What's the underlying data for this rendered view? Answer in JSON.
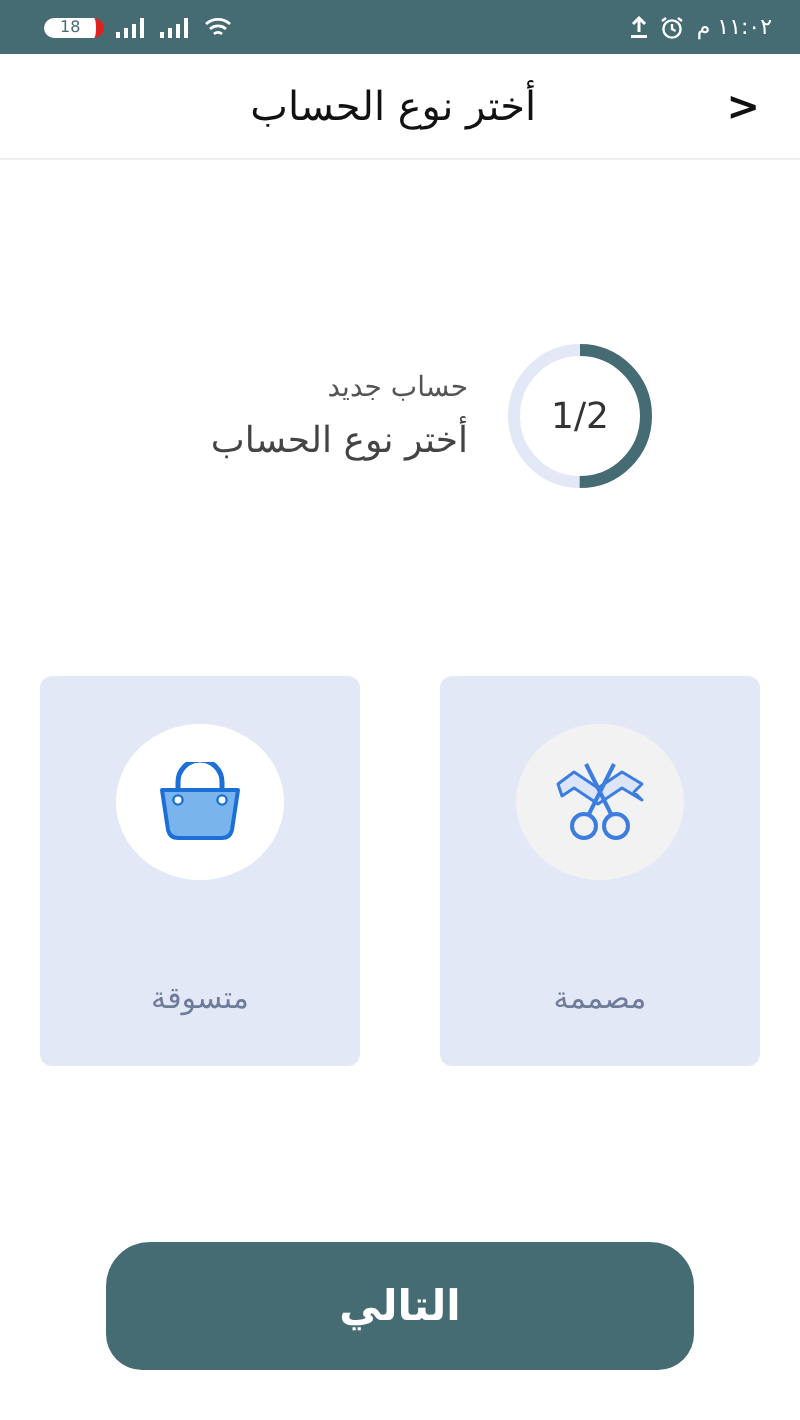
{
  "status_bar": {
    "battery": "18",
    "time": "١١:٠٢ م"
  },
  "header": {
    "title": "أختر نوع الحساب",
    "back": ">"
  },
  "progress": {
    "reading": "1/2",
    "level": 0.5,
    "subtitle": "حساب جديد",
    "title": "أختر نوع الحساب"
  },
  "cards": [
    {
      "label": "مصممة",
      "kind": "designer"
    },
    {
      "label": "متسوقة",
      "kind": "shopper"
    }
  ],
  "next_button": {
    "label": "التالي"
  }
}
